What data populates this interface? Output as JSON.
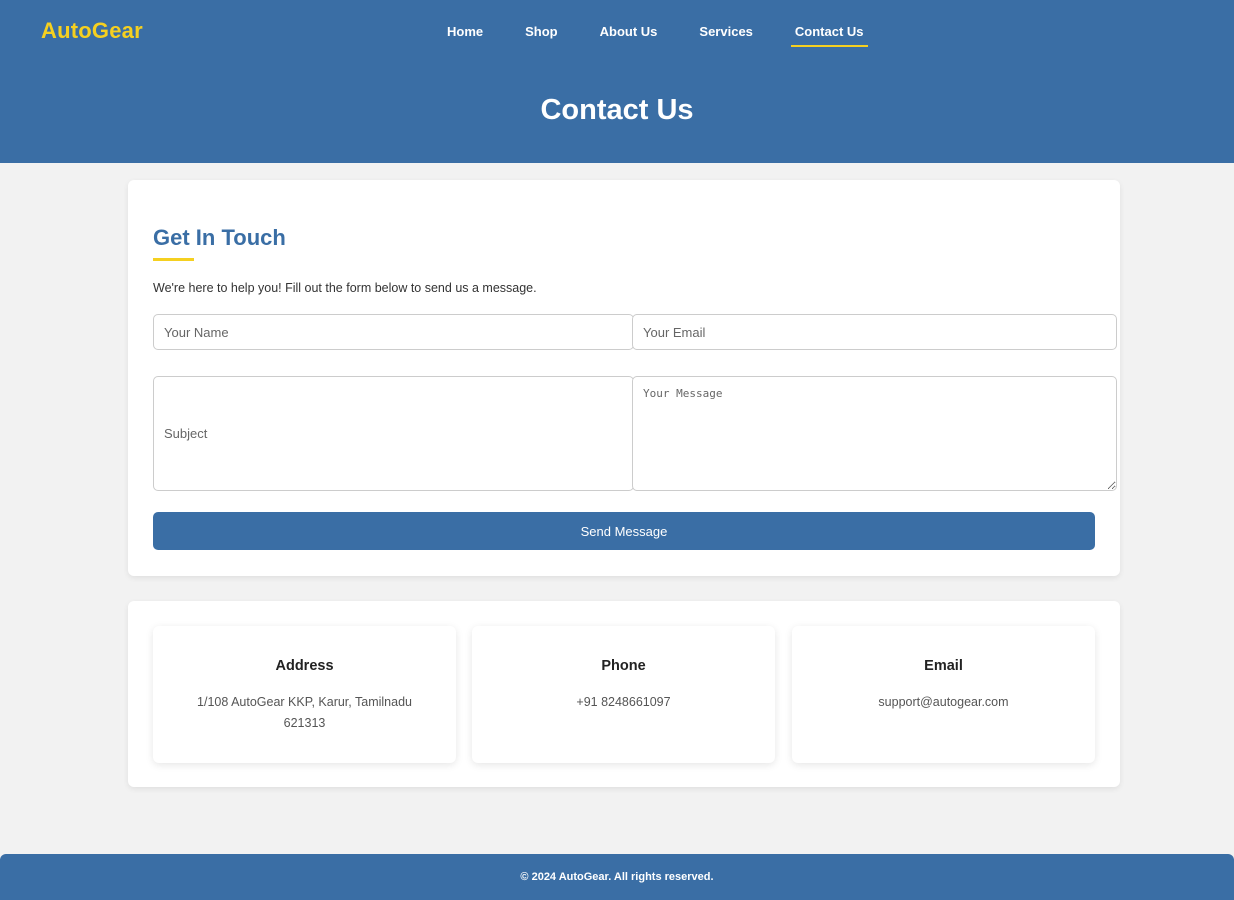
{
  "brand": {
    "logo": "AutoGear"
  },
  "nav": {
    "items": [
      {
        "label": "Home"
      },
      {
        "label": "Shop"
      },
      {
        "label": "About Us"
      },
      {
        "label": "Services"
      },
      {
        "label": "Contact Us"
      }
    ],
    "active": "Contact Us"
  },
  "hero": {
    "title": "Contact Us"
  },
  "form": {
    "heading": "Get In Touch",
    "intro": "We're here to help you! Fill out the form below to send us a message.",
    "name_placeholder": "Your Name",
    "email_placeholder": "Your Email",
    "subject_placeholder": "Subject",
    "message_placeholder": "Your Message",
    "submit_label": "Send Message"
  },
  "contact": {
    "address": {
      "title": "Address",
      "text": "1/108 AutoGear KKP, Karur, Tamilnadu 621313"
    },
    "phone": {
      "title": "Phone",
      "text": "+91 8248661097"
    },
    "email": {
      "title": "Email",
      "text": "support@autogear.com"
    }
  },
  "footer": {
    "copyright": "© 2024 AutoGear. All rights reserved."
  },
  "colors": {
    "primary": "#3a6ea5",
    "accent": "#f5d020",
    "background": "#f2f2f2"
  }
}
